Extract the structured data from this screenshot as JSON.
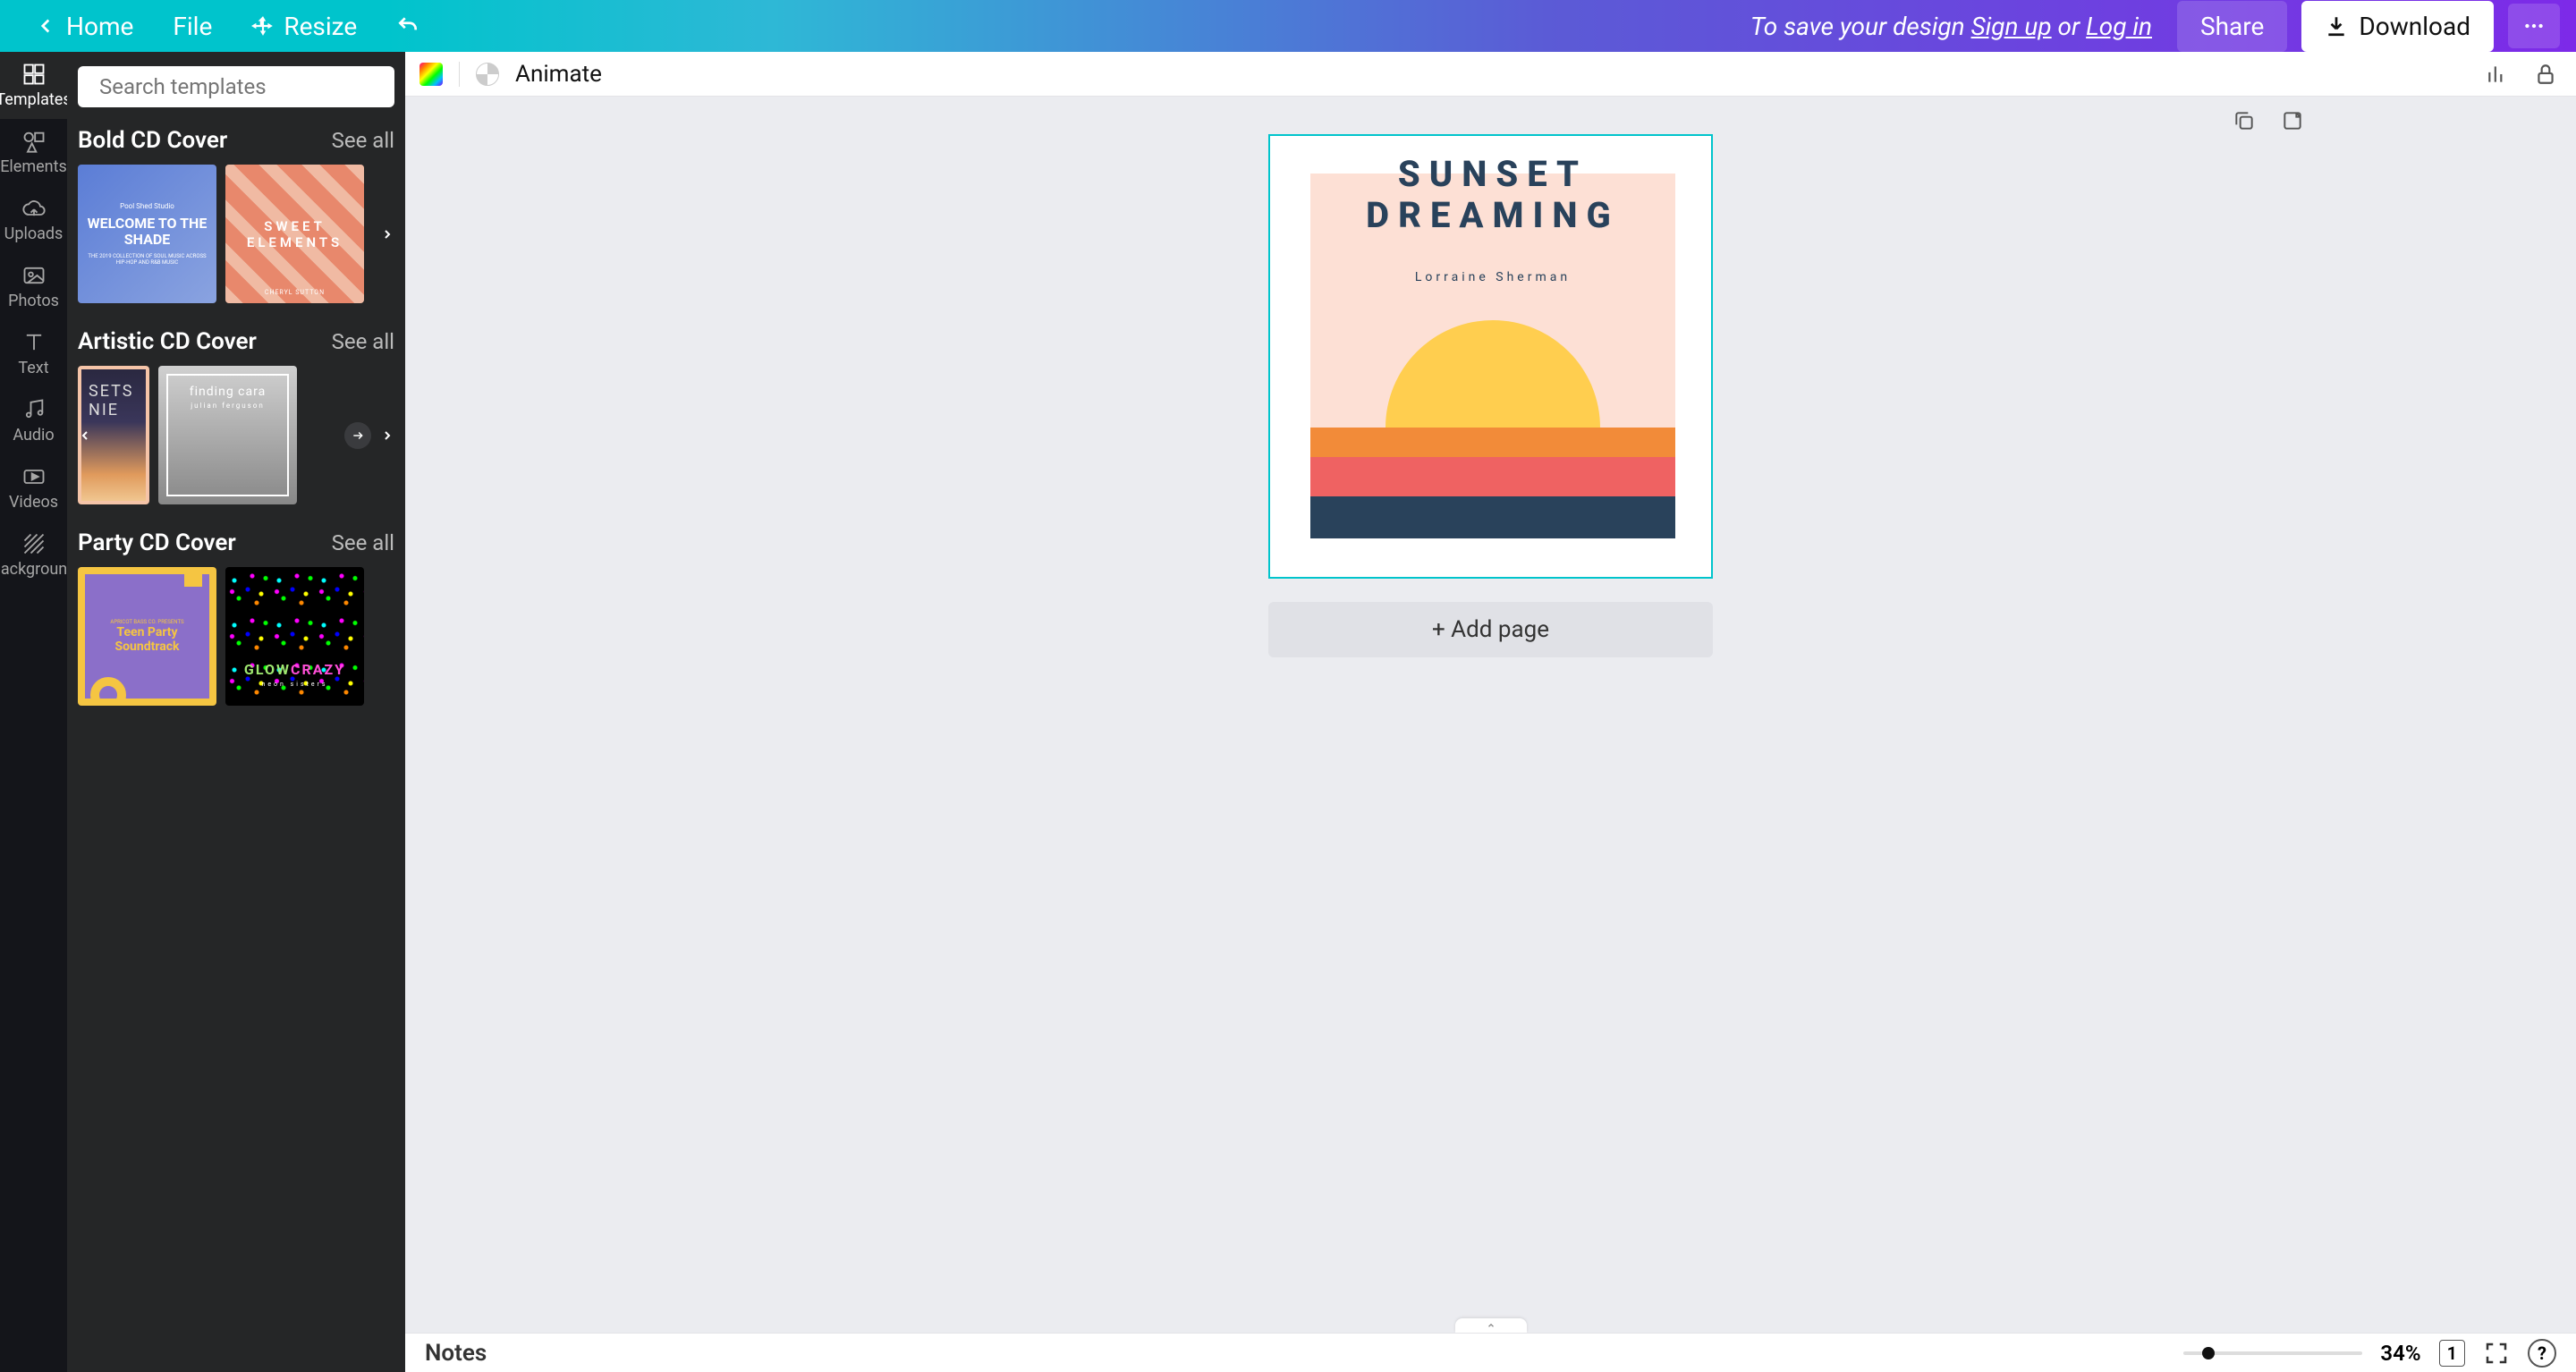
{
  "topbar": {
    "home": "Home",
    "file": "File",
    "resize": "Resize",
    "save_msg_prefix": "To save your design ",
    "signup": "Sign up",
    "or": " or ",
    "login": "Log in",
    "share": "Share",
    "download": "Download"
  },
  "rail": {
    "templates": "Templates",
    "elements": "Elements",
    "uploads": "Uploads",
    "photos": "Photos",
    "text": "Text",
    "audio": "Audio",
    "videos": "Videos",
    "background": "Background"
  },
  "search": {
    "placeholder": "Search templates"
  },
  "sections": {
    "bold": {
      "title": "Bold CD Cover",
      "see_all": "See all",
      "t1_small": "Pool Shed Studio",
      "t1_main": "WELCOME TO THE SHADE",
      "t1_tiny": "THE 2019 COLLECTION OF SOUL MUSIC ACROSS HIP-HOP AND R&B MUSIC",
      "t2_line1": "SWEET",
      "t2_line2": "ELEMENTS",
      "t2_sub": "CHERYL SUTTON"
    },
    "artistic": {
      "title": "Artistic CD Cover",
      "see_all": "See all",
      "t3_line1": "SETS",
      "t3_line2": "NIE",
      "t4_title": "finding cara",
      "t4_sub": "julian ferguson"
    },
    "party": {
      "title": "Party CD Cover",
      "see_all": "See all",
      "t5_small": "APRICOT BASS CO. PRESENTS",
      "t5_main": "Teen Party Soundtrack",
      "t6_w1": "GLOW",
      "t6_w2": "CRAZY",
      "t6_sub": "neon sisters"
    }
  },
  "toolbar": {
    "animate": "Animate"
  },
  "canvas": {
    "title_l1": "SUNSET",
    "title_l2": "DREAMING",
    "artist": "Lorraine Sherman",
    "colors": {
      "bg": "#FDE0D5",
      "sun": "#FFCE4F",
      "stripe1": "#F28B39",
      "stripe2": "#EF6262",
      "stripe3": "#29425B",
      "text": "#29425B"
    }
  },
  "add_page": "+ Add page",
  "bottombar": {
    "notes": "Notes",
    "zoom_pct": "34%",
    "page_num": "1"
  }
}
